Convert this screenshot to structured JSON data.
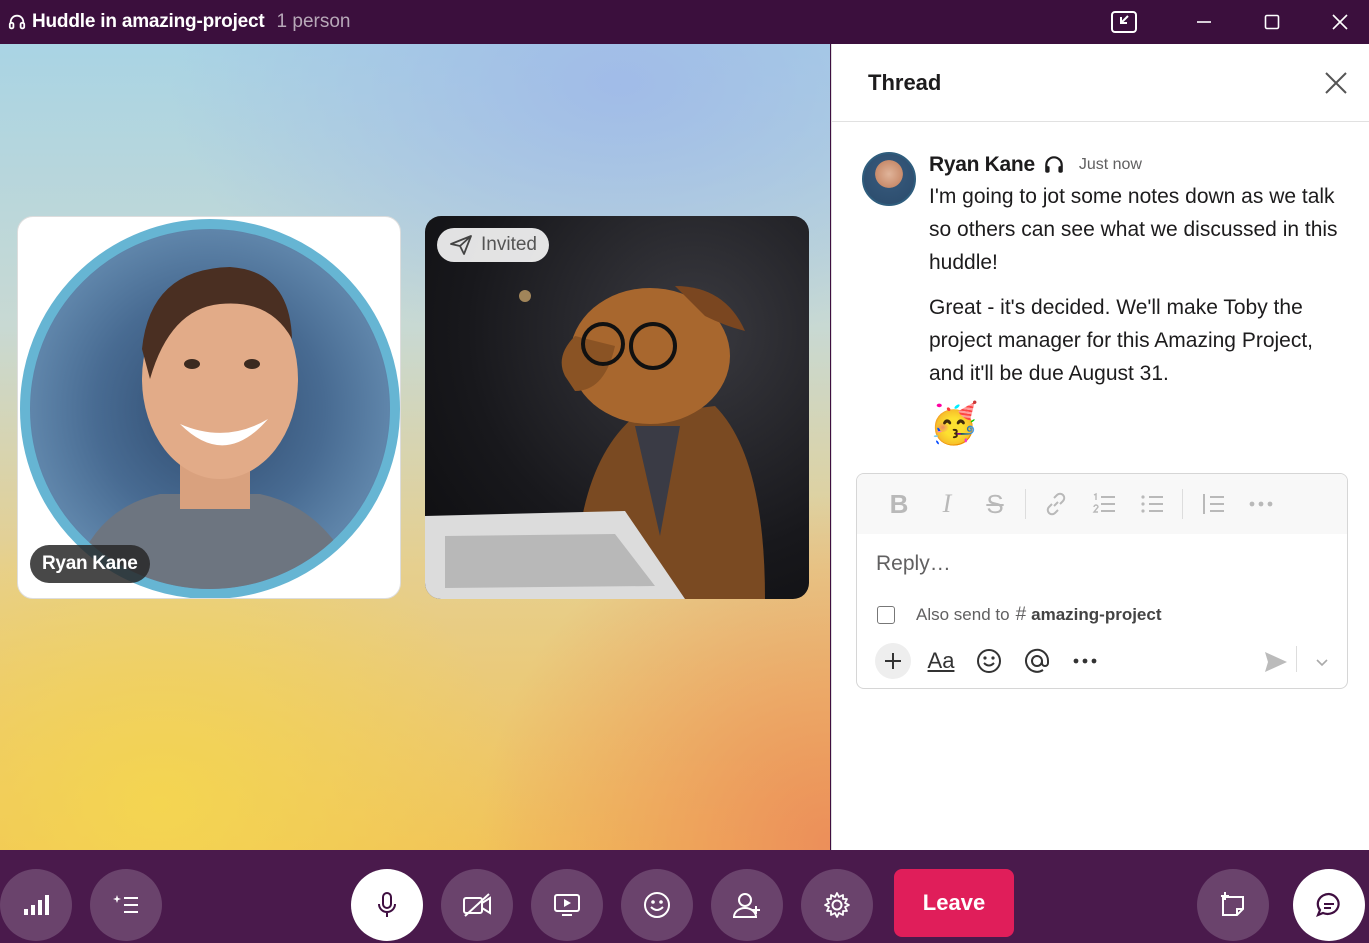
{
  "window": {
    "title": "Huddle in amazing-project",
    "participant_count": "1 person"
  },
  "stage": {
    "participant_name": "Ryan Kane",
    "invited_label": "Invited"
  },
  "thread": {
    "title": "Thread",
    "message": {
      "author": "Ryan Kane",
      "time": "Just now",
      "text1": "I'm going to jot some notes down as we talk so others can see what we discussed in this huddle!",
      "text2": "Great - it's decided. We'll make Toby the project manager for this Amazing Project, and it'll be due August 31.",
      "emoji": "🥳"
    },
    "composer": {
      "placeholder": "Reply…",
      "also_send_label": "Also send to",
      "channel_hash": "#",
      "channel": "amazing-project",
      "format_label": "Aa"
    }
  },
  "controls": {
    "leave_label": "Leave"
  },
  "colors": {
    "titlebar": "#3b0f3d",
    "controls_bg": "#4a1a4c",
    "leave": "#e01e5a",
    "avatar_ring": "#66b5d3"
  },
  "icons": [
    "headphones-icon",
    "picture-in-picture-icon",
    "minimize-icon",
    "maximize-icon",
    "close-icon",
    "send-paper-plane-icon",
    "bold-icon",
    "italic-icon",
    "strikethrough-icon",
    "link-icon",
    "numbered-list-icon",
    "bullet-list-icon",
    "blockquote-icon",
    "more-icon",
    "plus-icon",
    "emoji-icon",
    "mention-icon",
    "send-icon",
    "chevron-down-icon",
    "signal-icon",
    "checklist-icon",
    "microphone-icon",
    "video-off-icon",
    "screen-share-icon",
    "reactions-icon",
    "add-people-icon",
    "settings-icon",
    "sticky-note-icon",
    "chat-icon"
  ]
}
